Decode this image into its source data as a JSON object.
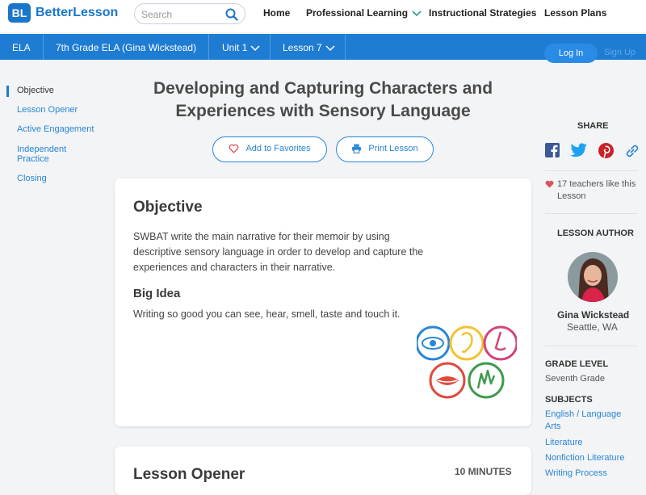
{
  "header": {
    "logo_abbr": "BL",
    "brand": "BetterLesson",
    "search_placeholder": "Search",
    "nav": [
      "Home",
      "Professional Learning",
      "Instructional Strategies",
      "Lesson Plans"
    ]
  },
  "breadcrumb": {
    "subject": "ELA",
    "course": "7th Grade ELA (Gina Wickstead)",
    "unit": "Unit 1",
    "lesson": "Lesson 7",
    "login": "Log In",
    "signup": "Sign Up"
  },
  "sidebar": {
    "items": [
      "Objective",
      "Lesson Opener",
      "Active Engagement",
      "Independent Practice",
      "Closing"
    ]
  },
  "lesson": {
    "title": "Developing and Capturing Characters and Experiences with Sensory Language",
    "add_favorites": "Add to Favorites",
    "print_lesson": "Print Lesson"
  },
  "objective": {
    "heading": "Objective",
    "text": "SWBAT write the main narrative for their memoir by using descriptive sensory language in order to develop and capture the experiences and characters in their narrative.",
    "big_idea_heading": "Big Idea",
    "big_idea_text": "Writing so good you can see, hear, smell, taste and touch it."
  },
  "next_section": {
    "heading": "Lesson Opener",
    "duration": "10 MINUTES"
  },
  "right_panel": {
    "share_label": "SHARE",
    "likes": "17 teachers like this Lesson",
    "author_label": "LESSON AUTHOR",
    "author_name": "Gina Wickstead",
    "author_location": "Seattle, WA",
    "grade_label": "GRADE LEVEL",
    "grade_value": "Seventh Grade",
    "subjects_label": "SUBJECTS",
    "subjects": [
      "English / Language Arts",
      "Literature",
      "Nonfiction Literature",
      "Writing Process"
    ]
  },
  "colors": {
    "brand_blue": "#1a76c8",
    "bar_blue": "#1e7cd2",
    "link_blue": "#2a86d6",
    "heart_red": "#e0505b"
  }
}
